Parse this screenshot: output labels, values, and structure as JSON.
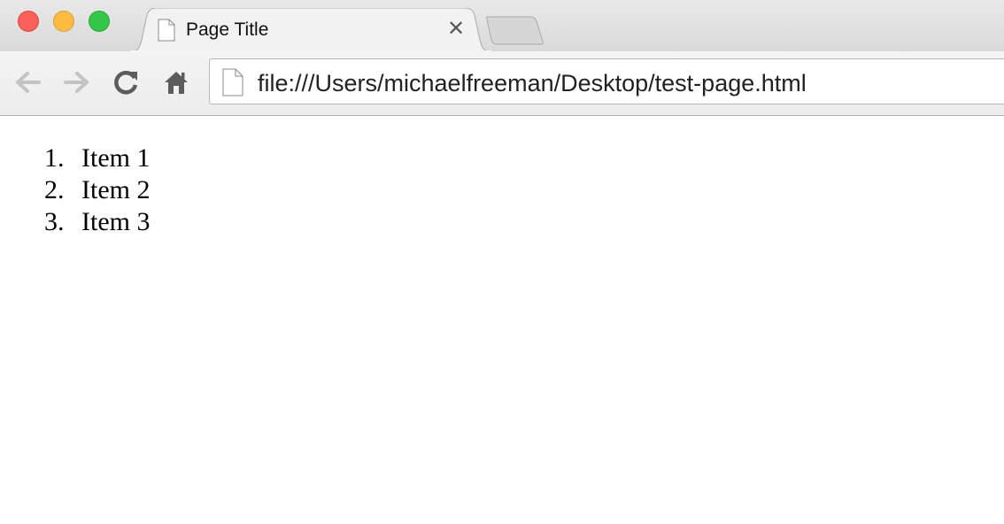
{
  "tab": {
    "title": "Page Title",
    "close_glyph": "✕"
  },
  "toolbar": {
    "back_icon": "arrow-left-icon",
    "forward_icon": "arrow-right-icon",
    "reload_icon": "reload-icon",
    "home_icon": "home-icon"
  },
  "address_bar": {
    "url": "file:///Users/michaelfreeman/Desktop/test-page.html"
  },
  "page": {
    "list": [
      {
        "number": "1.",
        "text": "Item 1"
      },
      {
        "number": "2.",
        "text": "Item 2"
      },
      {
        "number": "3.",
        "text": "Item 3"
      }
    ]
  },
  "colors": {
    "close_button": "#fc605b",
    "minimize_button": "#fdbc40",
    "maximize_button": "#34c84a"
  }
}
